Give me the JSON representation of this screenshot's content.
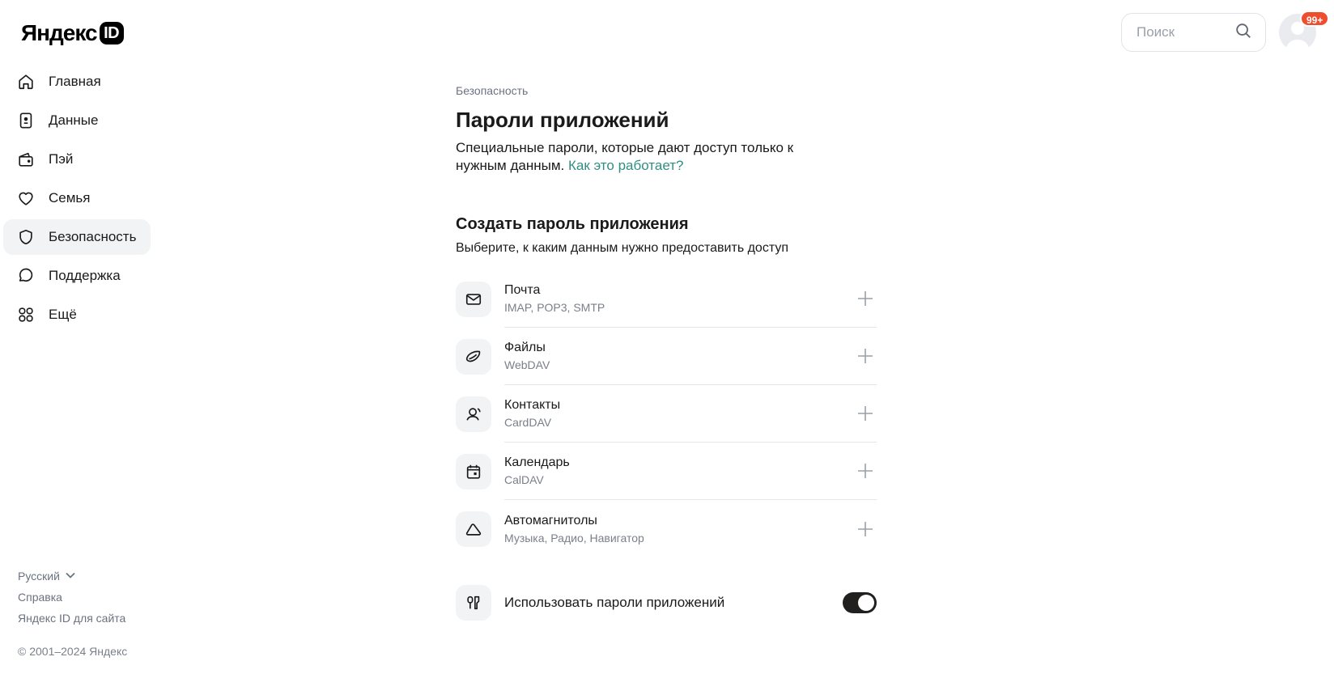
{
  "logo": {
    "brand": "Яндекс",
    "id": "ID"
  },
  "sidebar": {
    "items": [
      {
        "label": "Главная",
        "icon": "home-icon",
        "active": false
      },
      {
        "label": "Данные",
        "icon": "id-card-icon",
        "active": false
      },
      {
        "label": "Пэй",
        "icon": "wallet-icon",
        "active": false
      },
      {
        "label": "Семья",
        "icon": "heart-icon",
        "active": false
      },
      {
        "label": "Безопасность",
        "icon": "shield-icon",
        "active": true
      },
      {
        "label": "Поддержка",
        "icon": "chat-icon",
        "active": false
      },
      {
        "label": "Ещё",
        "icon": "grid-icon",
        "active": false
      }
    ],
    "footer": {
      "language": "Русский",
      "help": "Справка",
      "for_site": "Яндекс ID для сайта",
      "copyright": "© 2001–2024 Яндекс"
    }
  },
  "header": {
    "search_placeholder": "Поиск",
    "badge": "99+"
  },
  "main": {
    "breadcrumb": "Безопасность",
    "title": "Пароли приложений",
    "description": "Специальные пароли, которые дают доступ только к нужным данным.",
    "how_it_works": "Как это работает?",
    "section_title": "Создать пароль приложения",
    "section_subtitle": "Выберите, к каким данным нужно предоставить доступ",
    "services": [
      {
        "name": "Почта",
        "protocol": "IMAP, POP3, SMTP",
        "icon": "mail-icon"
      },
      {
        "name": "Файлы",
        "protocol": "WebDAV",
        "icon": "disk-icon"
      },
      {
        "name": "Контакты",
        "protocol": "CardDAV",
        "icon": "contacts-icon"
      },
      {
        "name": "Календарь",
        "protocol": "CalDAV",
        "icon": "calendar-icon"
      },
      {
        "name": "Автомагнитолы",
        "protocol": "Музыка, Радио, Навигатор",
        "icon": "car-icon"
      }
    ],
    "toggle": {
      "label": "Использовать пароли приложений",
      "on": true
    }
  },
  "colors": {
    "link": "#2f8f83",
    "active_bg": "#f2f3f5",
    "badge": "#ee4d2e",
    "toggle_on": "#21201f"
  }
}
